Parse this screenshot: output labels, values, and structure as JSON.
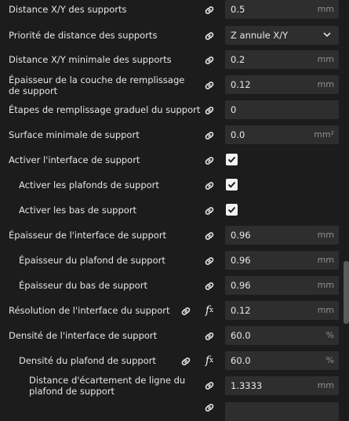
{
  "settings": [
    {
      "label": "Distance X/Y des supports",
      "value": "0.5",
      "unit": "mm"
    },
    {
      "label": "Priorité de distance des supports",
      "value": "Z annule X/Y"
    },
    {
      "label": "Distance X/Y minimale des supports",
      "value": "0.2",
      "unit": "mm"
    },
    {
      "label": "Épaisseur de la couche de remplissage de support",
      "value": "0.12",
      "unit": "mm"
    },
    {
      "label": "Étapes de remplissage graduel du support",
      "value": "0"
    },
    {
      "label": "Surface minimale de support",
      "value": "0.0",
      "unit": "mm²"
    },
    {
      "label": "Activer l'interface de support",
      "checked": true
    },
    {
      "label": "Activer les plafonds de support",
      "checked": true
    },
    {
      "label": "Activer les bas de support",
      "checked": true
    },
    {
      "label": "Épaisseur de l'interface de support",
      "value": "0.96",
      "unit": "mm"
    },
    {
      "label": "Épaisseur du plafond de support",
      "value": "0.96",
      "unit": "mm"
    },
    {
      "label": "Épaisseur du bas de support",
      "value": "0.96",
      "unit": "mm"
    },
    {
      "label": "Résolution de l'interface du support",
      "value": "0.12",
      "unit": "mm"
    },
    {
      "label": "Densité de l'interface de support",
      "value": "60.0",
      "unit": "%"
    },
    {
      "label": "Densité du plafond de support",
      "value": "60.0",
      "unit": "%"
    },
    {
      "label": "Distance d'écartement de ligne du plafond de support",
      "value": "1.3333",
      "unit": "mm"
    }
  ],
  "icons": {
    "link": "link-icon",
    "function": "function-icon",
    "check": "checkmark-icon",
    "chevron": "chevron-down-icon"
  }
}
